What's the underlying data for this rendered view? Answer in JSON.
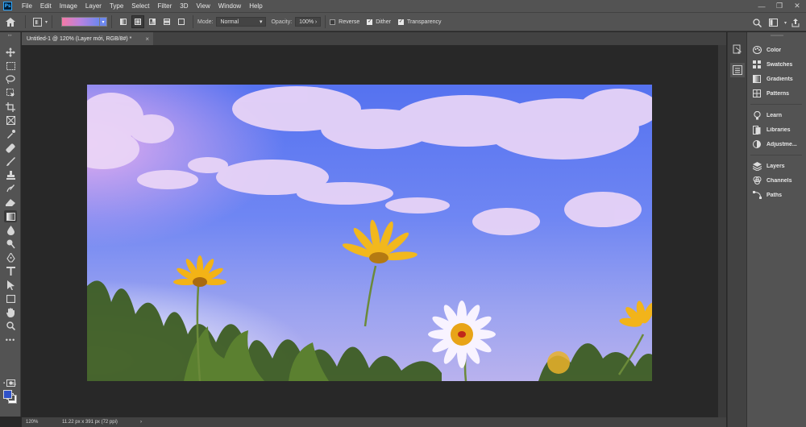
{
  "app": {
    "logo": "Ps"
  },
  "menu": [
    "File",
    "Edit",
    "Image",
    "Layer",
    "Type",
    "Select",
    "Filter",
    "3D",
    "View",
    "Window",
    "Help"
  ],
  "window_controls": {
    "minimize": "—",
    "restore": "❐",
    "close": "✕"
  },
  "options": {
    "gradient_colors": [
      "#f57aa6",
      "#b883e0",
      "#6d87ee"
    ],
    "mode_label": "Mode:",
    "mode_value": "Normal",
    "opacity_label": "Opacity:",
    "opacity_value": "100%",
    "reverse_label": "Reverse",
    "reverse_checked": false,
    "dither_label": "Dither",
    "dither_checked": true,
    "transparency_label": "Transparency",
    "transparency_checked": true
  },
  "document": {
    "tab_title": "Untitled-1 @ 120% (Layer mới, RGB/8#) *",
    "tab_close": "×"
  },
  "status": {
    "zoom": "120%",
    "doc_info": "11.22 px x 391 px (72 ppi)",
    "caret": "›"
  },
  "colors": {
    "foreground": "#2f52c9",
    "background": "#ffffff",
    "ui_dark": "#535353",
    "canvas_bg": "#282828"
  },
  "tools": [
    "move-icon",
    "marquee-icon",
    "lasso-icon",
    "object-select-icon",
    "crop-icon",
    "frame-icon",
    "eyedropper-icon",
    "healing-icon",
    "brush-icon",
    "stamp-icon",
    "history-brush-icon",
    "eraser-icon",
    "gradient-icon",
    "blur-icon",
    "dodge-icon",
    "pen-icon",
    "type-icon",
    "path-select-icon",
    "rectangle-icon",
    "hand-icon",
    "zoom-icon",
    "more-tools-icon"
  ],
  "panels": {
    "group1": [
      "Color",
      "Swatches",
      "Gradients",
      "Patterns"
    ],
    "group2": [
      "Learn",
      "Libraries",
      "Adjustme..."
    ],
    "group3": [
      "Layers",
      "Channels",
      "Paths"
    ]
  }
}
